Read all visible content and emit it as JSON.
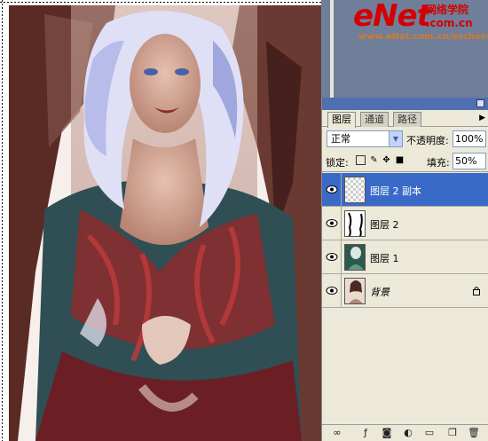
{
  "watermark": {
    "logo": "eNet",
    "chinese": "网络学院",
    "com": ".com.cn",
    "url": "www.eNet.com.cn/eschool"
  },
  "layers_panel": {
    "tabs": [
      {
        "label": "图层",
        "active": true
      },
      {
        "label": "通道",
        "active": false
      },
      {
        "label": "路径",
        "active": false
      }
    ],
    "blend_mode": "正常",
    "opacity_label": "不透明度:",
    "opacity_value": "100%",
    "lock_label": "锁定:",
    "fill_label": "填充:",
    "fill_value": "50%",
    "layers": [
      {
        "name": "图层 2 副本",
        "selected": true,
        "visible": true,
        "locked": false
      },
      {
        "name": "图层 2",
        "selected": false,
        "visible": true,
        "locked": false
      },
      {
        "name": "图层 1",
        "selected": false,
        "visible": true,
        "locked": false
      },
      {
        "name": "背景",
        "selected": false,
        "visible": true,
        "locked": true
      }
    ]
  },
  "colors": {
    "selection": "#3a6ac8",
    "panel_bg": "#ece9d8",
    "workspace": "#6f7f9a",
    "logo_red": "#d40000"
  }
}
